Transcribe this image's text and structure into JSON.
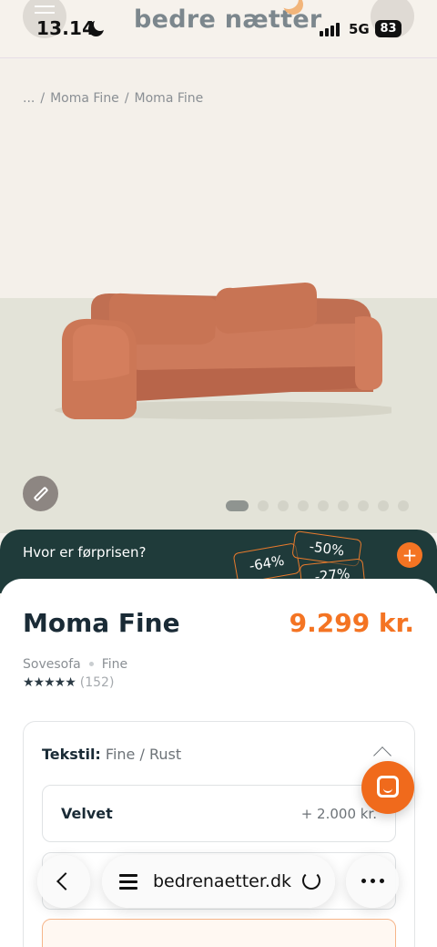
{
  "status_bar": {
    "time": "13.14",
    "network": "5G",
    "battery": "83"
  },
  "header": {
    "logo": "bedre nætter"
  },
  "breadcrumb": [
    "...",
    "/",
    "Moma Fine",
    "/",
    "Moma Fine"
  ],
  "promo": {
    "text": "Hvor er førprisen?",
    "tags": [
      "-64%",
      "-50%",
      "-27%"
    ],
    "plus": "+"
  },
  "product": {
    "title": "Moma Fine",
    "price": "9.299 kr.",
    "category": "Sovesofa",
    "collection": "Fine",
    "stars": "★★★★★",
    "rating_count": "(152)",
    "rating_value": 4.5,
    "color": "#c87454"
  },
  "textile": {
    "label": "Tekstil:",
    "selected": "Fine / Rust",
    "options": [
      {
        "name": "Velvet",
        "price": "+ 2.000 kr."
      },
      {
        "name": "",
        "price": ""
      },
      {
        "name": "",
        "price": ""
      }
    ]
  },
  "browser": {
    "url": "bedrenaetter.dk"
  },
  "gallery": {
    "slides": 9,
    "active": 0
  }
}
